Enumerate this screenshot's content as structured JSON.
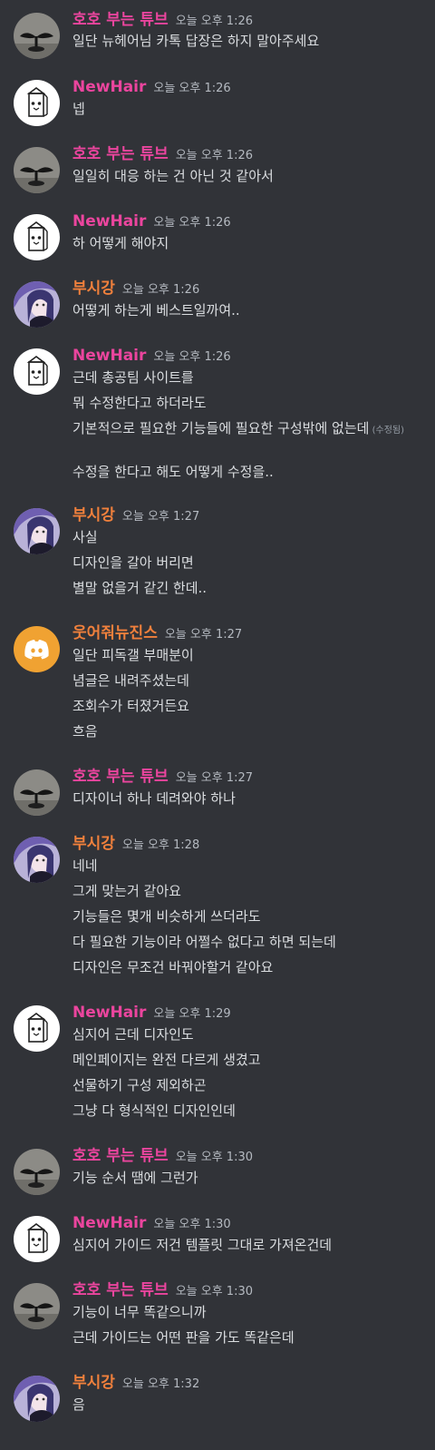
{
  "users": {
    "hoho": {
      "name": "호호 부는 튜브",
      "color": "#eb459e",
      "avatar": "seedling-avatar-icon"
    },
    "newhair": {
      "name": "NewHair",
      "color": "#eb459e",
      "avatar": "milk-carton-avatar-icon"
    },
    "busigang": {
      "name": "부시강",
      "color": "#f0803c",
      "avatar": "anime-girl-avatar-icon"
    },
    "useo": {
      "name": "웃어줘뉴진스",
      "color": "#f0803c",
      "avatar": "discord-logo-avatar-icon"
    }
  },
  "messages": [
    {
      "user": "hoho",
      "name": "호호 부는 튜브",
      "time": "오늘 오후 1:26",
      "lines": [
        "일단 뉴헤어님 카톡 답장은 하지 말아주세요"
      ]
    },
    {
      "user": "newhair",
      "name": "NewHair",
      "time": "오늘 오후 1:26",
      "lines": [
        "넵"
      ]
    },
    {
      "user": "hoho",
      "name": "호호 부는 튜브",
      "time": "오늘 오후 1:26",
      "lines": [
        "일일히 대응 하는 건 아닌 것 같아서"
      ]
    },
    {
      "user": "newhair",
      "name": "NewHair",
      "time": "오늘 오후 1:26",
      "lines": [
        "하 어떻게 해야지"
      ]
    },
    {
      "user": "busigang",
      "name": "부시강",
      "time": "오늘 오후 1:26",
      "lines": [
        "어떻게 하는게 베스트일까여.."
      ]
    },
    {
      "user": "newhair",
      "name": "NewHair",
      "time": "오늘 오후 1:26",
      "lines": [
        "근데 총공팀 사이트를",
        "뭐 수정한다고 하더라도",
        "기본적으로 필요한 기능들에 필요한 구성밖에 없는데",
        "수정을 한다고 해도 어떻게 수정을.."
      ],
      "edited": "(수정됨)"
    },
    {
      "user": "busigang",
      "name": "부시강",
      "time": "오늘 오후 1:27",
      "lines": [
        "사실",
        "디자인을 갈아 버리면",
        "별말 없을거 같긴 한데.."
      ]
    },
    {
      "user": "useo",
      "name": "웃어줘뉴진스",
      "time": "오늘 오후 1:27",
      "lines": [
        "일단 피독갤 부매분이",
        "념글은 내려주셨는데",
        "조회수가 터졌거든요",
        "흐음"
      ]
    },
    {
      "user": "hoho",
      "name": "호호 부는 튜브",
      "time": "오늘 오후 1:27",
      "lines": [
        "디자이너 하나 데려와야 하나"
      ]
    },
    {
      "user": "busigang",
      "name": "부시강",
      "time": "오늘 오후 1:28",
      "lines": [
        "네네",
        "그게 맞는거 같아요",
        "기능들은 몇개 비슷하게 쓰더라도",
        "다 필요한 기능이라 어쩔수 없다고 하면 되는데",
        "디자인은 무조건 바꿔야할거 같아요"
      ]
    },
    {
      "user": "newhair",
      "name": "NewHair",
      "time": "오늘 오후 1:29",
      "lines": [
        "심지어 근데 디자인도",
        "메인페이지는 완전 다르게 생겼고",
        "선물하기 구성 제외하곤",
        "그냥 다 형식적인 디자인인데"
      ]
    },
    {
      "user": "hoho",
      "name": "호호 부는 튜브",
      "time": "오늘 오후 1:30",
      "lines": [
        "기능 순서 땜에 그런가"
      ]
    },
    {
      "user": "newhair",
      "name": "NewHair",
      "time": "오늘 오후 1:30",
      "lines": [
        "심지어 가이드 저건 템플릿 그대로 가져온건데"
      ]
    },
    {
      "user": "hoho",
      "name": "호호 부는 튜브",
      "time": "오늘 오후 1:30",
      "lines": [
        "기능이 너무 똑같으니까",
        "근데 가이드는 어떤 판을 가도 똑같은데"
      ]
    },
    {
      "user": "busigang",
      "name": "부시강",
      "time": "오늘 오후 1:32",
      "lines": [
        "음"
      ]
    }
  ]
}
